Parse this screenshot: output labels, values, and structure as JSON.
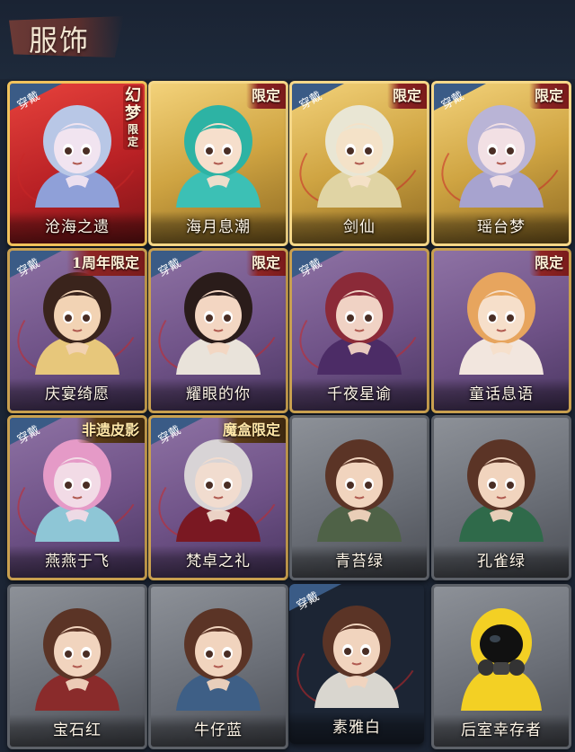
{
  "header": {
    "title": "服饰"
  },
  "equipped_label": "穿戴",
  "colors": {
    "background": "#1d2838",
    "equip_badge": "#3a5b86",
    "tag_red": "#8e2424",
    "frame_gold": "#f6d889"
  },
  "costumes": [
    {
      "name": "沧海之遗",
      "rarity": "red",
      "equipped": true,
      "tag_main": "幻梦",
      "tag_sub": "限定",
      "hair": "#b8c7e6",
      "skin": "#f1e4f0",
      "outfit": "#8fa0d8",
      "icon": "dreamy-hair-portrait"
    },
    {
      "name": "海月息潮",
      "rarity": "gold",
      "equipped": false,
      "tag": "限定",
      "hair": "#2db3a4",
      "skin": "#f6dfcc",
      "outfit": "#3cc0b5",
      "icon": "teal-hair-crown-portrait"
    },
    {
      "name": "剑仙",
      "rarity": "gold",
      "equipped": true,
      "tag": "限定",
      "hair": "#e9e6d4",
      "skin": "#f4e2c8",
      "outfit": "#e0d4a4",
      "icon": "silver-hair-portrait"
    },
    {
      "name": "瑶台梦",
      "rarity": "gold",
      "equipped": true,
      "tag": "限定",
      "hair": "#b9b4d6",
      "skin": "#f2e0e4",
      "outfit": "#a7a3cf",
      "icon": "lavender-hair-portrait"
    },
    {
      "name": "庆宴绮愿",
      "rarity": "purple",
      "equipped": true,
      "tag": "1周年限定",
      "hair": "#3a241c",
      "skin": "#f2d3b4",
      "outfit": "#e7c77b",
      "icon": "cake-portrait"
    },
    {
      "name": "耀眼的你",
      "rarity": "purple",
      "equipped": true,
      "tag": "限定",
      "hair": "#2a1c1a",
      "skin": "#f3d6c2",
      "outfit": "#e9e3da",
      "icon": "cowboy-hat-portrait"
    },
    {
      "name": "千夜星谕",
      "rarity": "purple",
      "equipped": true,
      "tag": "",
      "hair": "#8b2a38",
      "skin": "#f0d2c4",
      "outfit": "#4c2c66",
      "icon": "witch-hat-portrait"
    },
    {
      "name": "童话息语",
      "rarity": "purple",
      "equipped": false,
      "tag": "限定",
      "hair": "#e7a55e",
      "skin": "#f6dfca",
      "outfit": "#f2e6de",
      "icon": "red-bow-portrait"
    },
    {
      "name": "燕燕于飞",
      "rarity": "purple",
      "equipped": true,
      "tag": "非遗皮影",
      "tag_style": "gold",
      "hair": "#e59ac7",
      "skin": "#f2dbe6",
      "outfit": "#8ec6d6",
      "icon": "pink-hair-portrait"
    },
    {
      "name": "梵卓之礼",
      "rarity": "purple",
      "equipped": true,
      "tag": "魔盒限定",
      "tag_style": "gold",
      "hair": "#d8d4d6",
      "skin": "#f1dccf",
      "outfit": "#7a1822",
      "icon": "vampire-portrait"
    },
    {
      "name": "青苔绿",
      "rarity": "gray",
      "equipped": false,
      "tag": "",
      "hair": "#5b3426",
      "skin": "#f1d4be",
      "outfit": "#4f6247",
      "icon": "girl-green-portrait"
    },
    {
      "name": "孔雀绿",
      "rarity": "gray",
      "equipped": false,
      "tag": "",
      "hair": "#5b3426",
      "skin": "#f1d4be",
      "outfit": "#2f6a4a",
      "icon": "girl-peacock-portrait"
    },
    {
      "name": "宝石红",
      "rarity": "gray",
      "equipped": false,
      "tag": "",
      "hair": "#5b3426",
      "skin": "#f1d4be",
      "outfit": "#8a2b2b",
      "icon": "girl-red-portrait"
    },
    {
      "name": "牛仔蓝",
      "rarity": "gray",
      "equipped": false,
      "tag": "",
      "hair": "#5b3426",
      "skin": "#f1d4be",
      "outfit": "#3e5f86",
      "icon": "girl-denim-portrait"
    },
    {
      "name": "素雅白",
      "rarity": "equipped-gray",
      "equipped": true,
      "tag": "",
      "hair": "#5b3426",
      "skin": "#f1d4be",
      "outfit": "#d9d6cf",
      "icon": "girl-white-portrait"
    },
    {
      "name": "后室幸存者",
      "rarity": "gray",
      "equipped": false,
      "tag": "",
      "hair": "#f3d024",
      "skin": "#222222",
      "outfit": "#f3d024",
      "icon": "hazmat-gasmask-portrait"
    }
  ]
}
